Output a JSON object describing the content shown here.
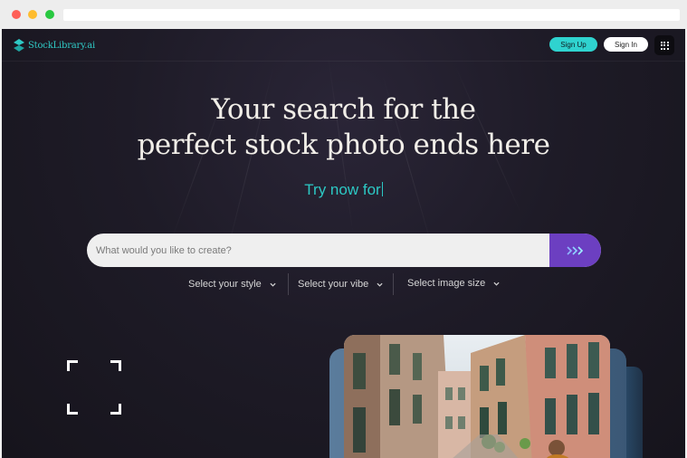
{
  "brand": {
    "name": "StockLibrary.ai",
    "accent": "#2fd3cf",
    "search_accent": "#6c3fc1"
  },
  "nav": {
    "signup_label": "Sign Up",
    "signin_label": "Sign In",
    "menu_icon": "grid-icon"
  },
  "hero": {
    "headline_line1": "Your search for the",
    "headline_line2": "perfect stock photo ends here",
    "try_now": "Try now for"
  },
  "search": {
    "placeholder": "What would you like to create?",
    "value": "",
    "submit_icon": "double-chevron-right-icon"
  },
  "filters": [
    {
      "label": "Select your style"
    },
    {
      "label": "Select your vibe"
    },
    {
      "label": "Select image size"
    }
  ],
  "decor": {
    "frame_icon": "focus-frame-icon",
    "photo": "street-photo"
  }
}
